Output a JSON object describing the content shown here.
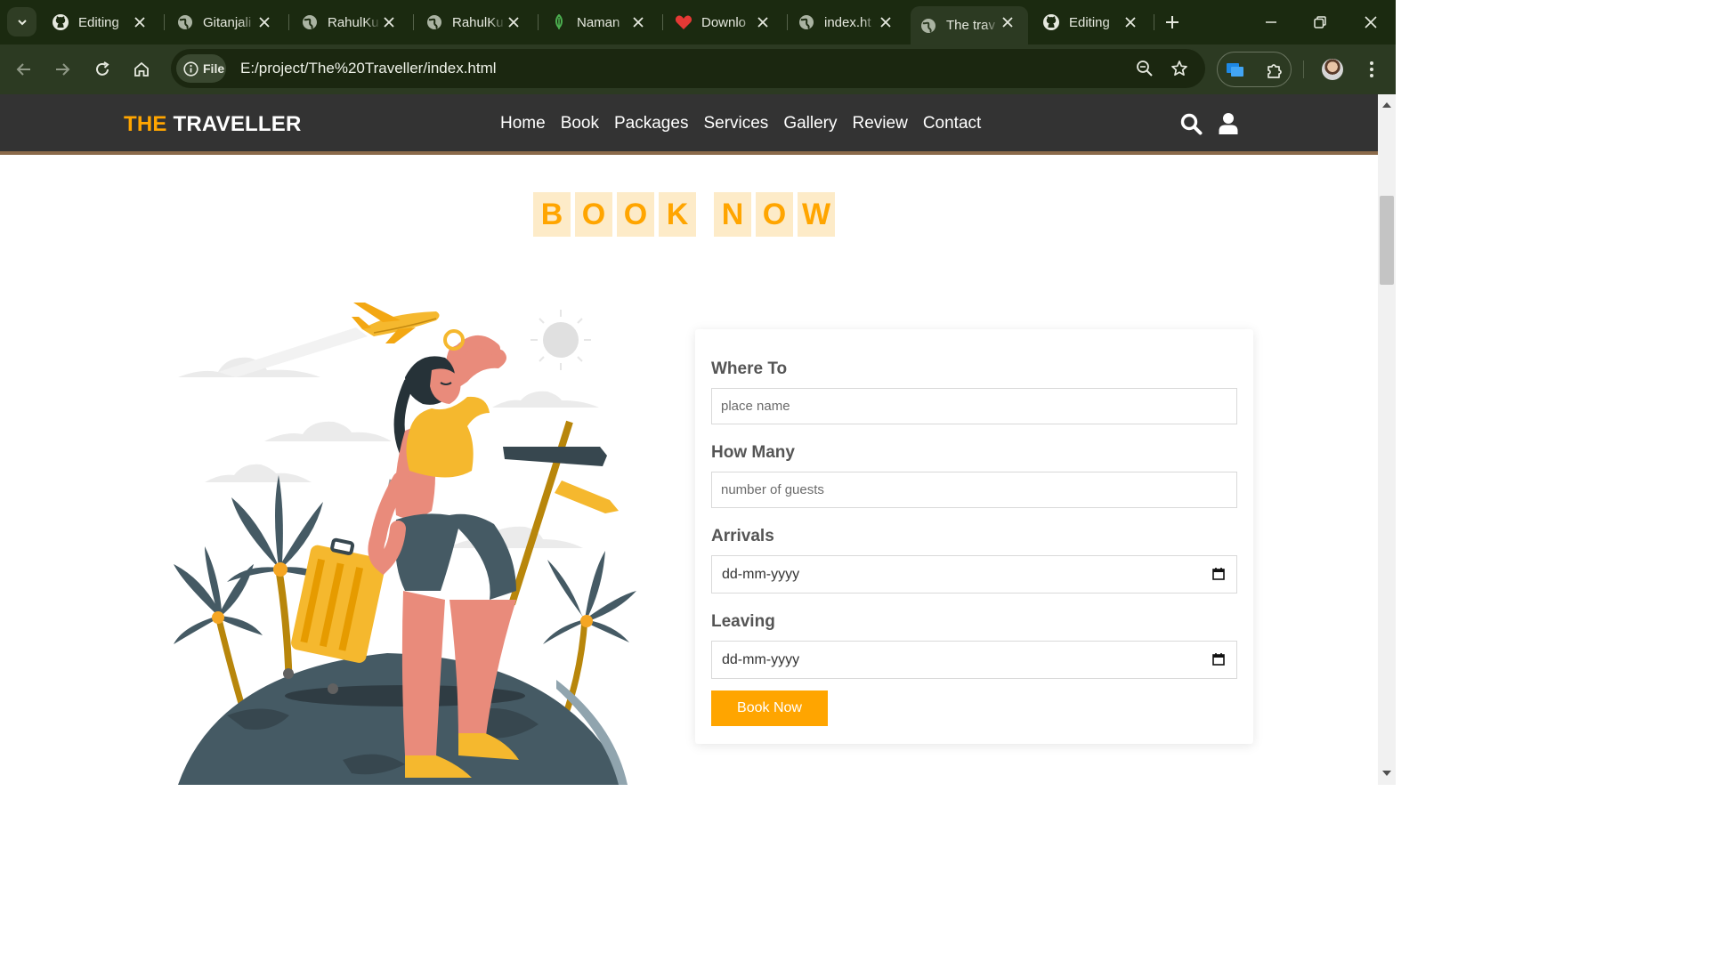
{
  "browser": {
    "tabs": [
      {
        "title": "Editing",
        "icon": "github-icon"
      },
      {
        "title": "Gitanjali",
        "icon": "globe-icon"
      },
      {
        "title": "RahulKu",
        "icon": "globe-icon"
      },
      {
        "title": "RahulKu",
        "icon": "globe-icon"
      },
      {
        "title": "Naman",
        "icon": "mongodb-leaf-icon"
      },
      {
        "title": "Downlo",
        "icon": "heart-icon"
      },
      {
        "title": "index.ht",
        "icon": "globe-icon"
      },
      {
        "title": "The trav",
        "icon": "globe-icon",
        "active": true
      },
      {
        "title": "Editing",
        "icon": "github-icon"
      }
    ],
    "chip_label": "File",
    "url": "E:/project/The%20Traveller/index.html"
  },
  "site": {
    "logo_accent": "THE",
    "logo_rest": " TRAVELLER",
    "nav": [
      "Home",
      "Book",
      "Packages",
      "Services",
      "Gallery",
      "Review",
      "Contact"
    ]
  },
  "heading": {
    "word1": [
      "B",
      "O",
      "O",
      "K"
    ],
    "word2": [
      "N",
      "O",
      "W"
    ]
  },
  "form": {
    "where_label": "Where To",
    "where_placeholder": "place name",
    "howmany_label": "How Many",
    "howmany_placeholder": "number of guests",
    "arrivals_label": "Arrivals",
    "arrivals_value": "dd-mm-yyyy",
    "leaving_label": "Leaving",
    "leaving_value": "dd-mm-yyyy",
    "submit_label": "Book Now"
  },
  "colors": {
    "accent": "#ffa500",
    "header_bg": "#333333",
    "browser_frame": "#1b2a10"
  }
}
